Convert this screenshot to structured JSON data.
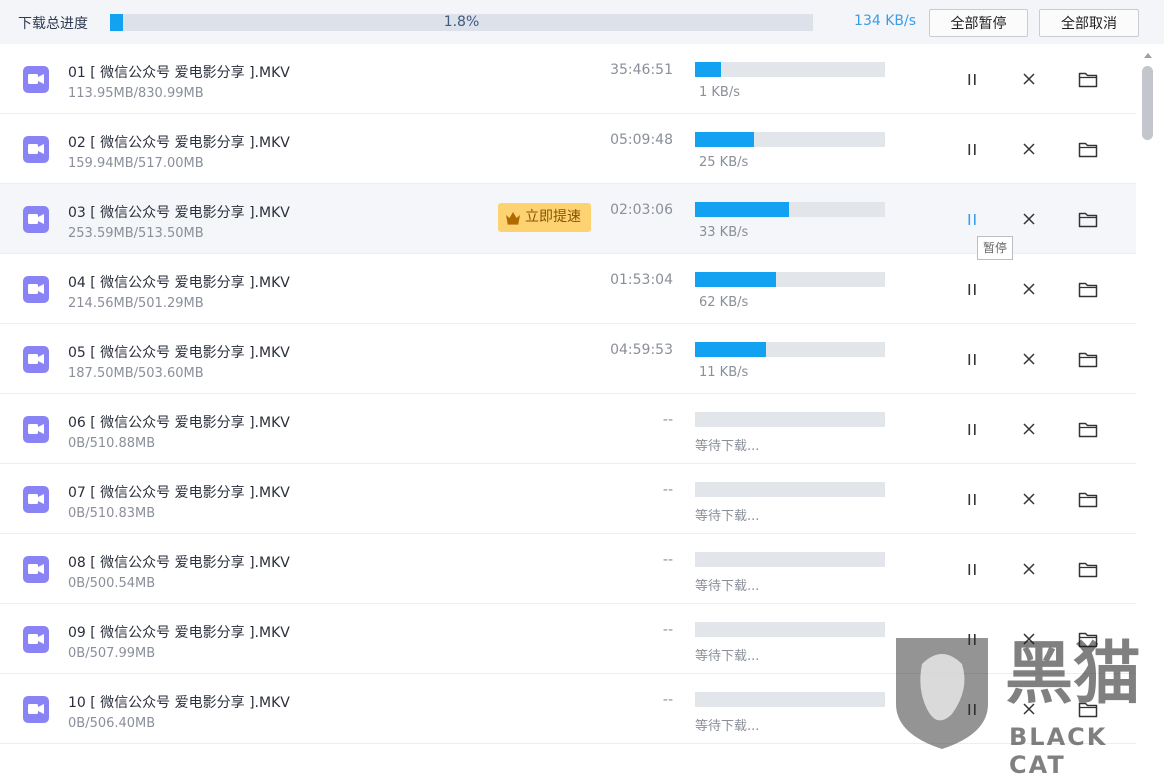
{
  "header": {
    "label": "下载总进度",
    "progress_percent": 1.8,
    "progress_text": "1.8%",
    "speed": "134 KB/s",
    "pause_all": "全部暂停",
    "cancel_all": "全部取消"
  },
  "colors": {
    "accent": "#13a2f1",
    "file_icon": "#8a83f5",
    "boost_bg": "#fdd372",
    "hover_pause": "#3aa0ea"
  },
  "rows": [
    {
      "name": "01 [ 微信公众号 爱电影分享 ].MKV",
      "size": "113.95MB/830.99MB",
      "eta": "35:46:51",
      "progress": 13.7,
      "speed": "1 KB/s"
    },
    {
      "name": "02 [ 微信公众号 爱电影分享 ].MKV",
      "size": "159.94MB/517.00MB",
      "eta": "05:09:48",
      "progress": 30.9,
      "speed": "25 KB/s"
    },
    {
      "name": "03 [ 微信公众号 爱电影分享 ].MKV",
      "size": "253.59MB/513.50MB",
      "eta": "02:03:06",
      "progress": 49.4,
      "speed": "33 KB/s",
      "boost": "立即提速",
      "highlight": true
    },
    {
      "name": "04 [ 微信公众号 爱电影分享 ].MKV",
      "size": "214.56MB/501.29MB",
      "eta": "01:53:04",
      "progress": 42.8,
      "speed": "62 KB/s"
    },
    {
      "name": "05 [ 微信公众号 爱电影分享 ].MKV",
      "size": "187.50MB/503.60MB",
      "eta": "04:59:53",
      "progress": 37.2,
      "speed": "11 KB/s"
    },
    {
      "name": "06 [ 微信公众号 爱电影分享 ].MKV",
      "size": "0B/510.88MB",
      "eta": "--",
      "progress": 0,
      "speed": "等待下载..."
    },
    {
      "name": "07 [ 微信公众号 爱电影分享 ].MKV",
      "size": "0B/510.83MB",
      "eta": "--",
      "progress": 0,
      "speed": "等待下载..."
    },
    {
      "name": "08 [ 微信公众号 爱电影分享 ].MKV",
      "size": "0B/500.54MB",
      "eta": "--",
      "progress": 0,
      "speed": "等待下载..."
    },
    {
      "name": "09 [ 微信公众号 爱电影分享 ].MKV",
      "size": "0B/507.99MB",
      "eta": "--",
      "progress": 0,
      "speed": "等待下载..."
    },
    {
      "name": "10 [ 微信公众号 爱电影分享 ].MKV",
      "size": "0B/506.40MB",
      "eta": "--",
      "progress": 0,
      "speed": "等待下载..."
    }
  ],
  "tooltip": "暂停",
  "watermark": {
    "cn": "黑猫",
    "en": "BLACK CAT"
  }
}
